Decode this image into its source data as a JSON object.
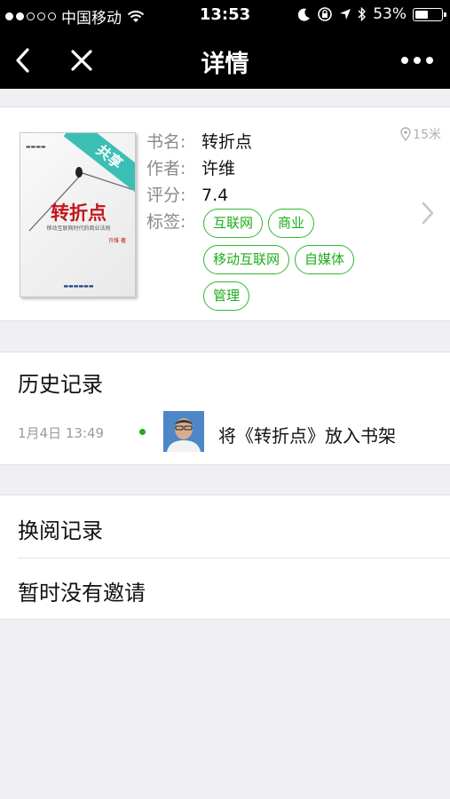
{
  "status": {
    "carrier": "中国移动",
    "time": "13:53",
    "battery": "53%",
    "battery_level": 0.53,
    "signal_dots_on": 2,
    "signal_dots_total": 5
  },
  "nav": {
    "title": "详情",
    "back_icon": "chevron-left-icon",
    "close_icon": "close-icon",
    "more_icon": "more-icon"
  },
  "book": {
    "cover": {
      "badge": "共享",
      "title": "转折点",
      "subtitle": "移动互联网时代的商业法则",
      "author_mark": "许维 著"
    },
    "title_label": "书名:",
    "title": "转折点",
    "author_label": "作者:",
    "author": "许维",
    "rating_label": "评分:",
    "rating": "7.4",
    "tags_label": "标签:",
    "tags": [
      "互联网",
      "商业",
      "移动互联网",
      "自媒体",
      "管理"
    ],
    "distance": "15米"
  },
  "history": {
    "heading": "历史记录",
    "entries": [
      {
        "time": "1月4日 13:49",
        "action": "将《转折点》放入书架"
      }
    ]
  },
  "lists": {
    "exchange": "换阅记录",
    "invites": "暂时没有邀请"
  },
  "colors": {
    "accent_green": "#1aad19",
    "nav_bg": "#000000",
    "page_bg": "#efeff4"
  }
}
